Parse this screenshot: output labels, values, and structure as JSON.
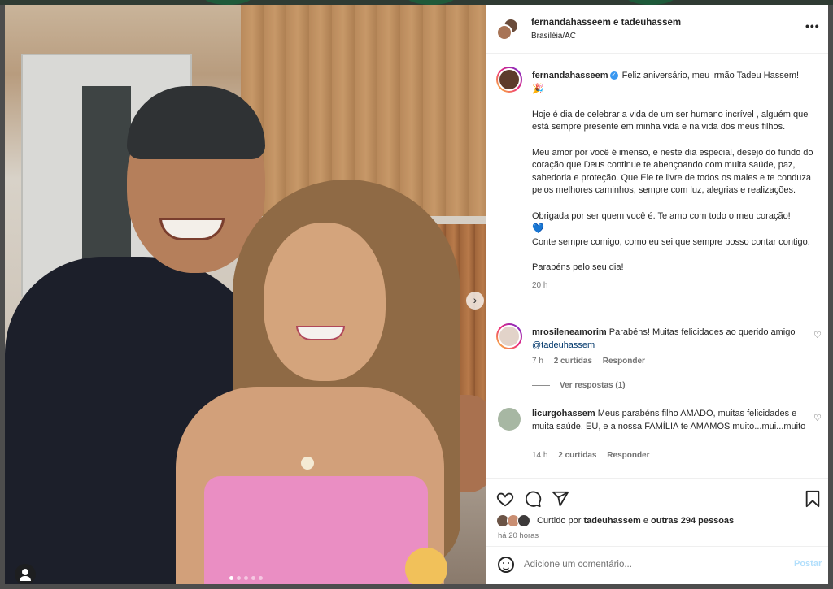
{
  "post": {
    "header": {
      "accounts": "fernandahasseem e tadeuhassem",
      "location": "Brasiléia/AC",
      "more_icon": "more-icon"
    },
    "caption": {
      "username": "fernandahasseem",
      "verified": true,
      "line1": "Feliz aniversário, meu irmão Tadeu Hassem!",
      "party_emoji": "🎉",
      "p1": "Hoje é dia de celebrar a vida de um ser humano incrível , alguém que está sempre presente em minha vida e na vida dos meus filhos.",
      "p2": "Meu amor por você é imenso, e neste dia especial, desejo do fundo do coração que Deus continue te abençoando com muita saúde, paz, sabedoria e proteção. Que Ele te livre de todos os males e te conduza pelos melhores caminhos, sempre com luz, alegrias e realizações.",
      "p3": "Obrigada por ser quem você é. Te amo com todo o meu coração!",
      "heart_emoji": "💙",
      "p4": "Conte sempre comigo, como eu sei que sempre posso contar contigo.",
      "p5": "Parabéns pelo seu dia!",
      "time": "20 h"
    },
    "comments": [
      {
        "username": "mrosileneamorim",
        "text": "Parabéns! Muitas felicidades ao querido amigo",
        "mention": "@tadeuhassem",
        "time": "7 h",
        "likes": "2 curtidas",
        "reply": "Responder",
        "view_replies": "Ver respostas (1)"
      },
      {
        "username": "licurgohassem",
        "text": "Meus parabéns filho AMADO, muitas felicidades e muita saúde. EU, e a nossa FAMÍLIA te AMAMOS muito...mui...muito",
        "time": "14 h",
        "likes": "2 curtidas",
        "reply": "Responder"
      }
    ],
    "likes": {
      "prefix": "Curtido por",
      "user": "tadeuhassem",
      "conj": "e",
      "others": "outras 294 pessoas"
    },
    "ago": "há 20 horas",
    "add_comment": {
      "placeholder": "Adicione um comentário...",
      "post_label": "Postar"
    },
    "carousel": {
      "slides": 5,
      "active": 1,
      "next_icon": "›"
    }
  }
}
